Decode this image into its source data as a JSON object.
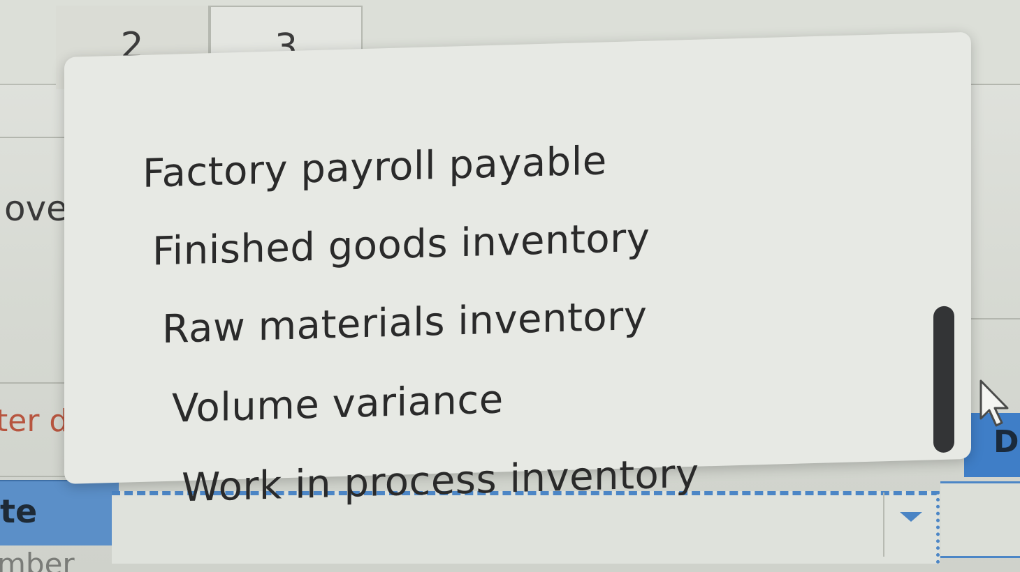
{
  "tabs": [
    {
      "label": "2"
    },
    {
      "label": "3"
    }
  ],
  "background": {
    "left_text_1": "ove",
    "left_text_2": "ter det",
    "left_text_3": "te",
    "left_text_4": "mber",
    "right_text": "D"
  },
  "dropdown": {
    "options": [
      "Factory payroll payable",
      "Finished goods inventory",
      "Raw materials inventory",
      "Volume variance",
      "Work in process inventory"
    ]
  },
  "colors": {
    "accent_blue": "#4c86c6",
    "error_text": "#b7553f",
    "scroll_thumb": "#333436"
  },
  "icons": {
    "select_arrow": "chevron-down-icon",
    "pointer": "mouse-pointer-icon"
  }
}
